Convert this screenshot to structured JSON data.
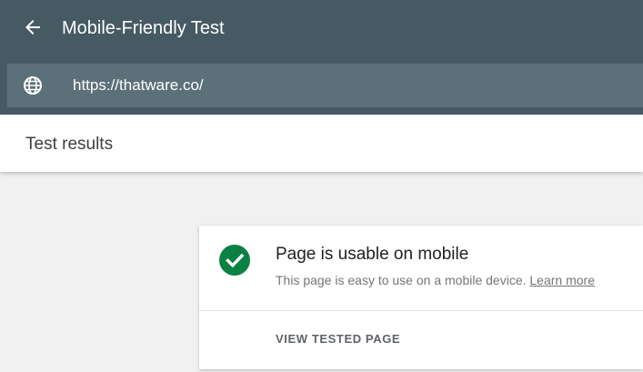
{
  "header": {
    "title": "Mobile-Friendly Test",
    "back_icon": "arrow-back-icon"
  },
  "url_bar": {
    "icon": "globe-icon",
    "value": "https://thatware.co/"
  },
  "results": {
    "title": "Test results"
  },
  "card": {
    "status_icon": "check-circle-icon",
    "status_color": "#0b8043",
    "title": "Page is usable on mobile",
    "description": "This page is easy to use on a mobile device.",
    "learn_more": "Learn more",
    "action_label": "VIEW TESTED PAGE"
  },
  "colors": {
    "topbar": "#465a64",
    "urlbar": "#5c707a",
    "background": "#f1f1f1"
  }
}
